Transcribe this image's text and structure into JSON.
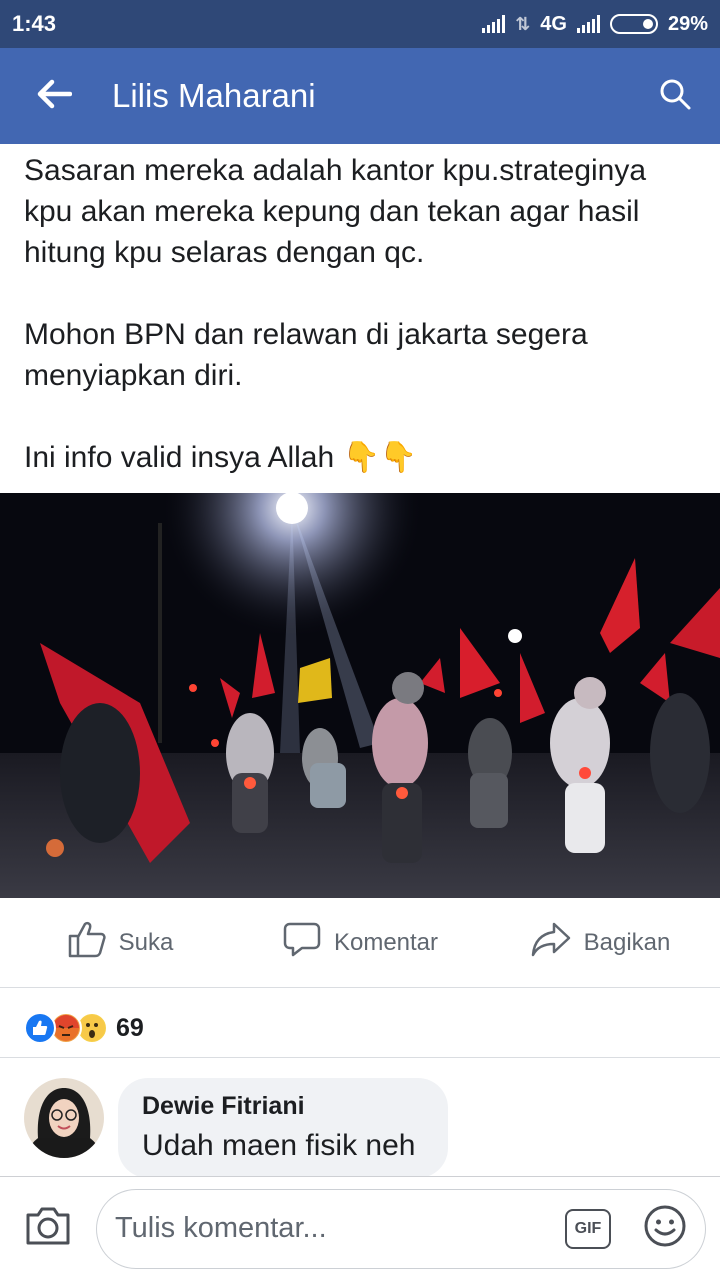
{
  "status_bar": {
    "time": "1:43",
    "network": "4G",
    "battery": "29%"
  },
  "header": {
    "title": "Lilis Maharani"
  },
  "post": {
    "paragraphs": [
      "Sasaran mereka adalah kantor kpu.strateginya kpu akan mereka kepung dan tekan agar hasil hitung kpu selaras dengan qc.",
      "Mohon BPN dan relawan di jakarta segera menyiapkan diri.",
      "Ini info valid insya Allah 👇👇"
    ]
  },
  "actions": {
    "like": "Suka",
    "comment": "Komentar",
    "share": "Bagikan"
  },
  "reactions": {
    "count": "69",
    "types": [
      "like-icon",
      "angry-icon",
      "wow-icon"
    ]
  },
  "comment": {
    "author": "Dewie Fitriani",
    "text": "Udah maen fisik neh"
  },
  "composer": {
    "placeholder": "Tulis komentar...",
    "gif_label": "GIF"
  },
  "colors": {
    "header": "#4267b2",
    "status_bar": "#2f4877",
    "like_blue": "#1877f2"
  }
}
